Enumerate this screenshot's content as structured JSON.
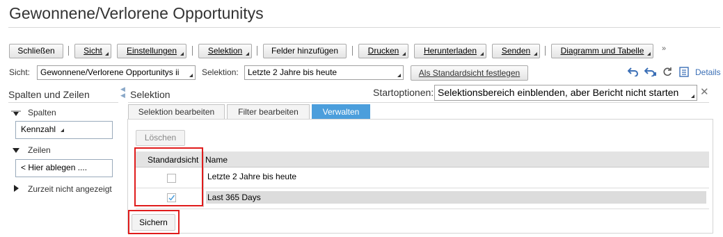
{
  "page_title": "Gewonnene/Verlorene Opportunitys",
  "toolbar": {
    "close": "Schließen",
    "view": "Sicht",
    "settings": "Einstellungen",
    "selection": "Selektion",
    "add_fields": "Felder hinzufügen",
    "print": "Drucken",
    "download": "Herunterladen",
    "send": "Senden",
    "chart_table": "Diagramm und Tabelle",
    "overflow": "»"
  },
  "view_bar": {
    "view_label": "Sicht:",
    "view_value": "Gewonnene/Verlorene Opportunitys ii",
    "selection_label": "Selektion:",
    "selection_value": "Letzte 2 Jahre bis heute",
    "set_default": "Als Standardsicht festlegen",
    "details": "Details"
  },
  "sidebar": {
    "heading": "Spalten und Zeilen",
    "columns_label": "Spalten",
    "columns_item": "Kennzahl",
    "rows_label": "Zeilen",
    "rows_placeholder": "< Hier ablegen ....",
    "hidden_label": "Zurzeit nicht angezeigt"
  },
  "main": {
    "heading": "Selektion",
    "start_options_label": "Startoptionen:",
    "start_options_value": "Selektionsbereich einblenden, aber Bericht nicht starten",
    "tabs": [
      "Selektion bearbeiten",
      "Filter bearbeiten",
      "Verwalten"
    ],
    "active_tab": "Verwalten",
    "delete_button": "Löschen",
    "table": {
      "headers": [
        "Standardsicht",
        "Name"
      ],
      "rows": [
        {
          "name": "Letzte 2 Jahre bis heute",
          "default": false
        },
        {
          "name": "Last 365 Days",
          "default": true
        }
      ]
    },
    "save_button": "Sichern"
  },
  "colors": {
    "accent": "#4b9edc",
    "link": "#3b6fb6",
    "highlight": "#e01b1b"
  }
}
